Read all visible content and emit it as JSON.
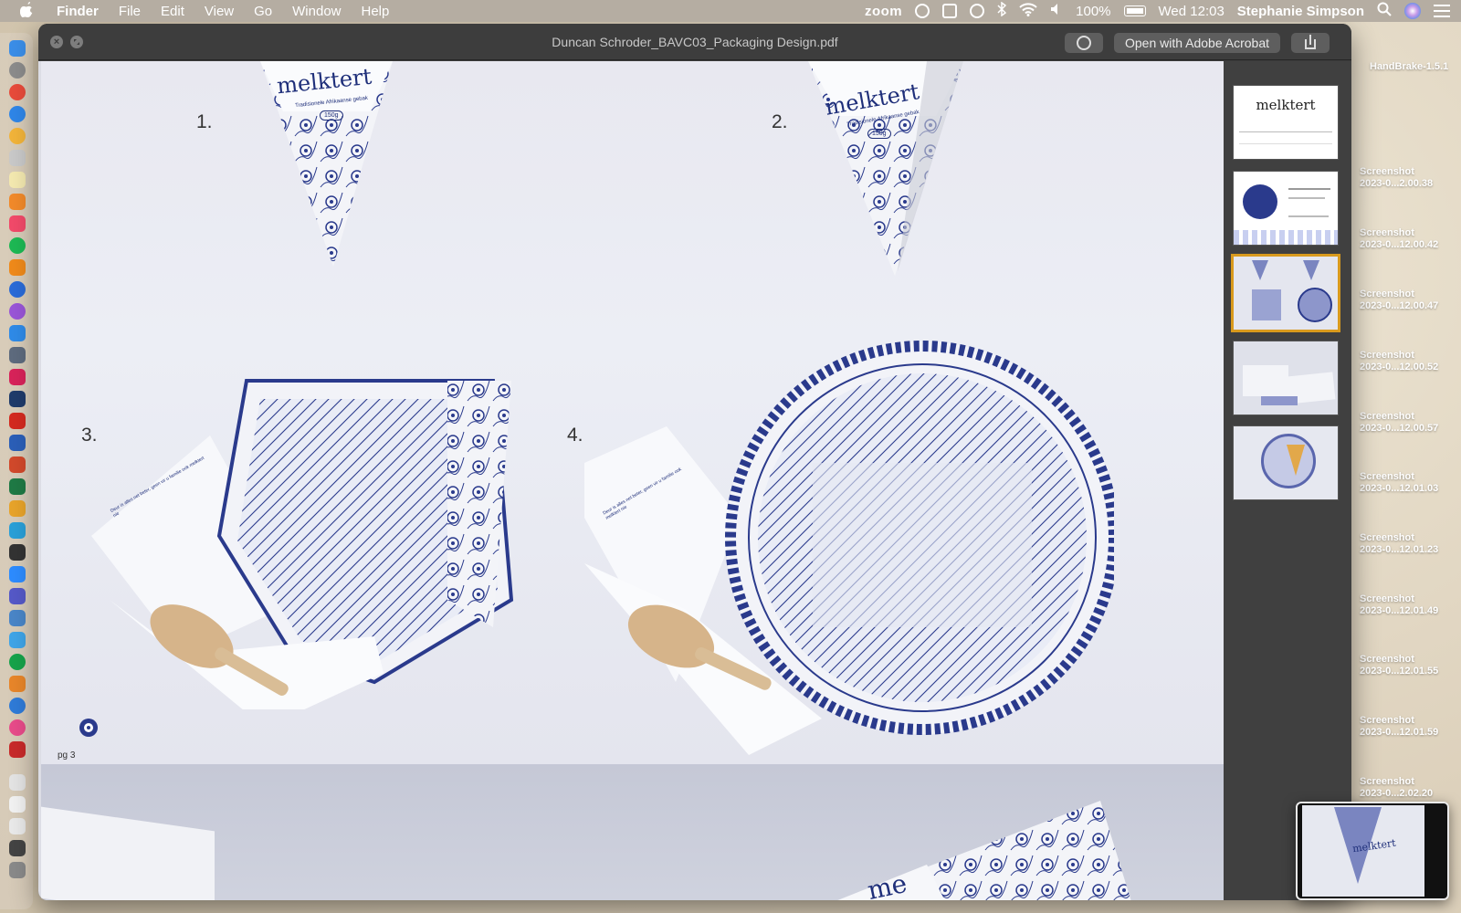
{
  "menubar": {
    "app_name": "Finder",
    "menus": [
      "File",
      "Edit",
      "View",
      "Go",
      "Window",
      "Help"
    ],
    "zoom_label": "zoom",
    "battery": "100%",
    "datetime": "Wed 12:03",
    "user": "Stephanie Simpson"
  },
  "window": {
    "title": "Duncan Schroder_BAVC03_Packaging Design.pdf",
    "open_with_label": "Open with Adobe Acrobat"
  },
  "page": {
    "numbers": [
      "1.",
      "2.",
      "3.",
      "4."
    ],
    "brand": "melktert",
    "tagline": "Tradisionele Afrikaanse gebak",
    "weight": "150g",
    "page_label": "pg 3",
    "flap_text": "Deur is alles net beter, geen vir u familie ook melktert nie"
  },
  "thumbnails": {
    "first_title": "melktert",
    "selected_index": 2,
    "count": 5
  },
  "desktop": {
    "handbrake": "HandBrake-1.5.1",
    "files": [
      {
        "line1": "Screenshot",
        "line2": "2023-0...2.00.38"
      },
      {
        "line1": "Screenshot",
        "line2": "2023-0...12.00.42"
      },
      {
        "line1": "Screenshot",
        "line2": "2023-0...12.00.47"
      },
      {
        "line1": "Screenshot",
        "line2": "2023-0...12.00.52"
      },
      {
        "line1": "Screenshot",
        "line2": "2023-0...12.00.57"
      },
      {
        "line1": "Screenshot",
        "line2": "2023-0...12.01.03"
      },
      {
        "line1": "Screenshot",
        "line2": "2023-0...12.01.23"
      },
      {
        "line1": "Screenshot",
        "line2": "2023-0...12.01.49"
      },
      {
        "line1": "Screenshot",
        "line2": "2023-0...12.01.55"
      },
      {
        "line1": "Screenshot",
        "line2": "2023-0...12.01.59"
      },
      {
        "line1": "Screenshot",
        "line2": "2023-0...2.02.20"
      }
    ]
  },
  "colors": {
    "porcelain_blue": "#2a3a8c",
    "selection": "#d99a1d",
    "menubar": "#b5ada2"
  }
}
